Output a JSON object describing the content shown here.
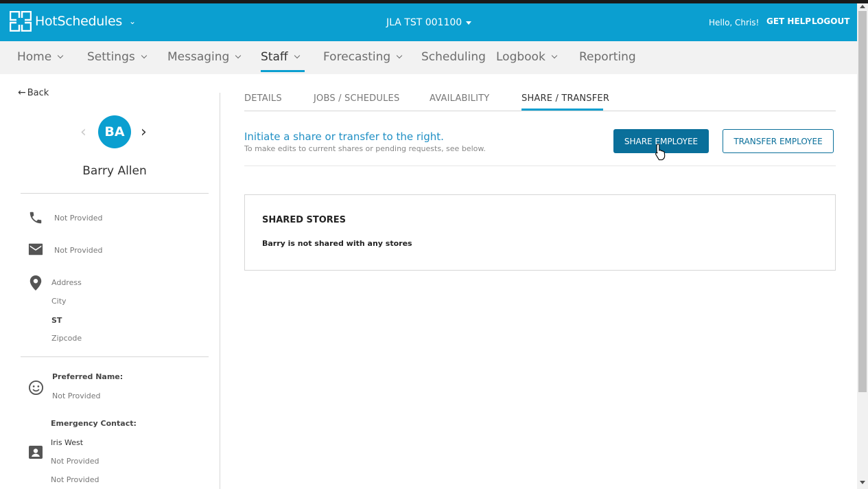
{
  "header": {
    "logo_text": "HotSchedules",
    "store": "JLA TST 001100",
    "greeting": "Hello, Chris!",
    "get_help": "GET HELP",
    "logout": "LOGOUT",
    "accent_color": "#0b9fd0"
  },
  "nav": {
    "items": [
      {
        "label": "Home",
        "has_dropdown": true
      },
      {
        "label": "Settings",
        "has_dropdown": true
      },
      {
        "label": "Messaging",
        "has_dropdown": true
      },
      {
        "label": "Staff",
        "has_dropdown": true,
        "active": true
      },
      {
        "label": "Forecasting",
        "has_dropdown": true
      },
      {
        "label": "Scheduling",
        "has_dropdown": false
      },
      {
        "label": "Logbook",
        "has_dropdown": true
      },
      {
        "label": "Reporting",
        "has_dropdown": false
      }
    ]
  },
  "sidebar": {
    "back_label": "Back",
    "initials": "BA",
    "name": "Barry Allen",
    "phone": "Not Provided",
    "email": "Not Provided",
    "address": "Address",
    "city": "City",
    "state": "ST",
    "zipcode": "Zipcode",
    "preferred_name_label": "Preferred Name:",
    "preferred_name": "Not Provided",
    "emergency_contact_label": "Emergency Contact:",
    "emergency_contact_name": "Iris West",
    "emergency_contact_phone": "Not Provided",
    "emergency_contact_relation": "Not Provided"
  },
  "tabs": [
    {
      "label": "DETAILS"
    },
    {
      "label": "JOBS / SCHEDULES"
    },
    {
      "label": "AVAILABILITY"
    },
    {
      "label": "SHARE / TRANSFER",
      "active": true
    }
  ],
  "share": {
    "headline": "Initiate a share or transfer to the right.",
    "subtext": "To make edits to current shares or pending requests, see below.",
    "share_button": "SHARE EMPLOYEE",
    "transfer_button": "TRANSFER EMPLOYEE",
    "shared_stores_title": "SHARED STORES",
    "shared_stores_message": "Barry is not shared with any stores"
  }
}
